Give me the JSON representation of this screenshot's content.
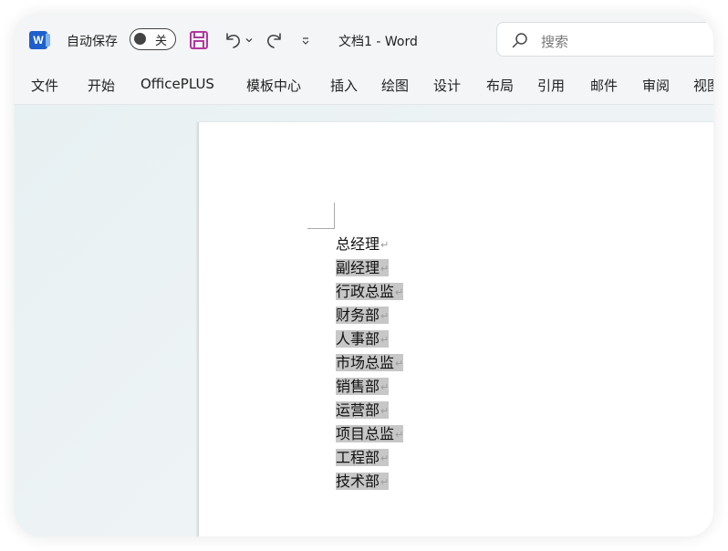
{
  "app": {
    "logo_letter": "W",
    "autosave_label": "自动保存",
    "autosave_state": "关",
    "document_title": "文档1 - Word"
  },
  "search": {
    "placeholder": "搜索"
  },
  "tabs": [
    {
      "label": "文件"
    },
    {
      "label": "开始"
    },
    {
      "label": "OfficePLUS"
    },
    {
      "label": "模板中心"
    },
    {
      "label": "插入"
    },
    {
      "label": "绘图"
    },
    {
      "label": "设计"
    },
    {
      "label": "布局"
    },
    {
      "label": "引用"
    },
    {
      "label": "邮件"
    },
    {
      "label": "审阅"
    },
    {
      "label": "视图"
    }
  ],
  "document": {
    "paragraph_mark": "↵",
    "lines": [
      {
        "text": "总经理",
        "selected": false
      },
      {
        "text": "副经理",
        "selected": true
      },
      {
        "text": "行政总监",
        "selected": true
      },
      {
        "text": "财务部",
        "selected": true
      },
      {
        "text": "人事部",
        "selected": true
      },
      {
        "text": "市场总监",
        "selected": true
      },
      {
        "text": "销售部",
        "selected": true
      },
      {
        "text": "运营部",
        "selected": true
      },
      {
        "text": "项目总监",
        "selected": true
      },
      {
        "text": "工程部",
        "selected": true
      },
      {
        "text": "技术部",
        "selected": true
      }
    ]
  },
  "colors": {
    "word_blue": "#1e5fcc",
    "save_purple": "#b2389f",
    "selection_gray": "#c7c7c7"
  },
  "icons": {
    "save": "save-icon",
    "undo": "undo-icon",
    "redo": "redo-icon",
    "search": "search-icon"
  }
}
